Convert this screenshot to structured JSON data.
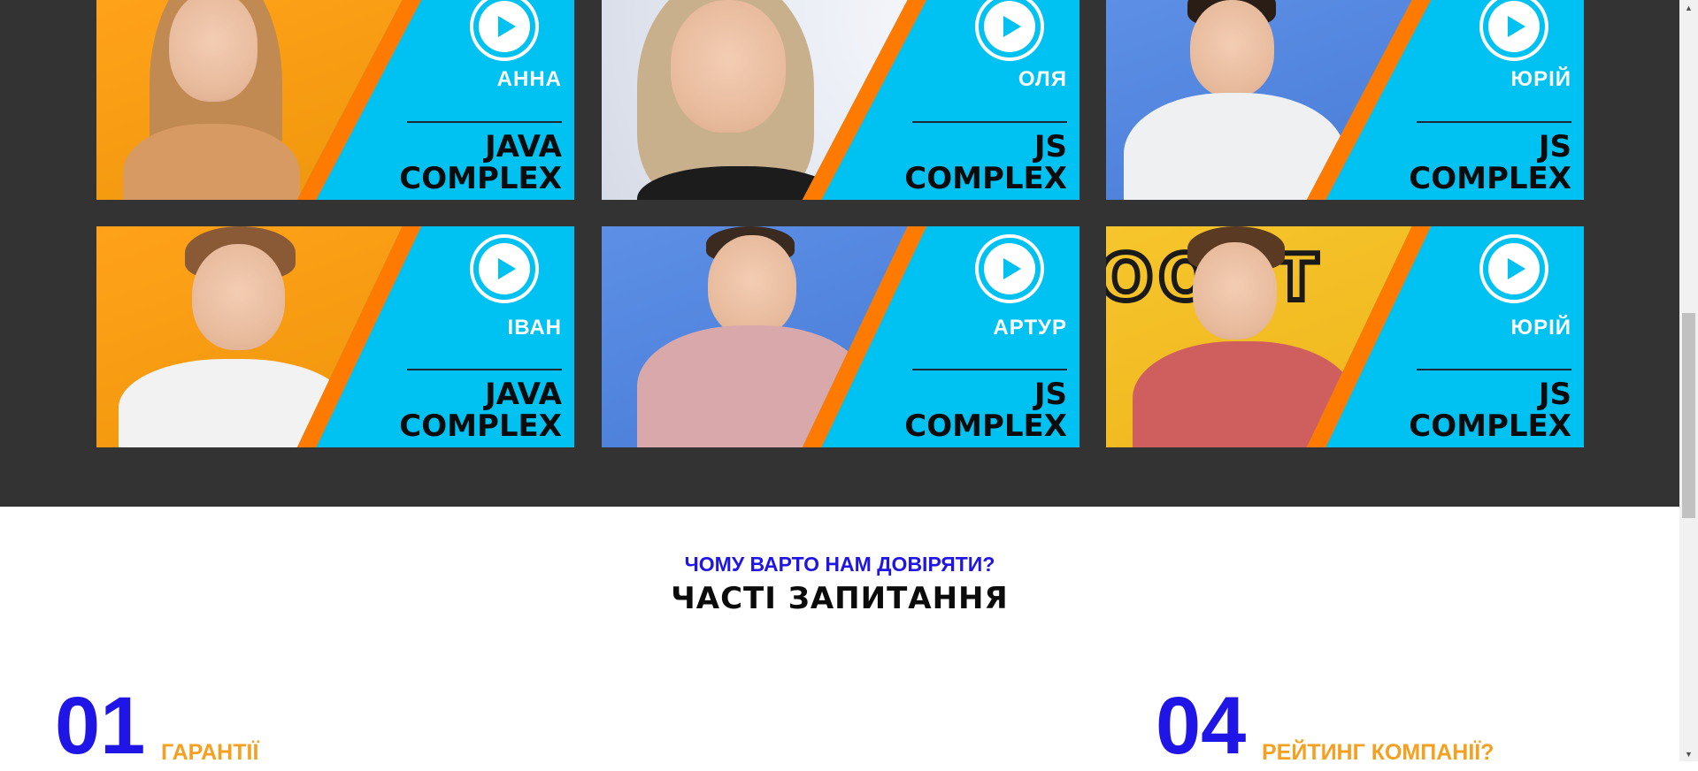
{
  "colors": {
    "dark_band": "#333333",
    "card_cyan": "#00c2f2",
    "card_stripe": "#ff7a00",
    "accent_blue": "#1f15e6",
    "accent_orange": "#f5a020"
  },
  "testimonials": {
    "cards": [
      {
        "name": "АННА",
        "course": "JAVA\nCOMPLEX",
        "icon": "play-icon"
      },
      {
        "name": "ОЛЯ",
        "course": "JS\nCOMPLEX",
        "icon": "play-icon"
      },
      {
        "name": "ЮРІЙ",
        "course": "JS\nCOMPLEX",
        "icon": "play-icon"
      },
      {
        "name": "ІВАН",
        "course": "JAVA\nCOMPLEX",
        "icon": "play-icon"
      },
      {
        "name": "АРТУР",
        "course": "JS\nCOMPLEX",
        "icon": "play-icon"
      },
      {
        "name": "ЮРІЙ",
        "course": "JS\nCOMPLEX",
        "icon": "play-icon"
      }
    ]
  },
  "faq": {
    "subtitle": "ЧОМУ ВАРТО НАМ ДОВІРЯТИ?",
    "title": "ЧАСТІ ЗАПИТАННЯ",
    "items": [
      {
        "number": "01",
        "label": "ГАРАНТІЇ"
      },
      {
        "number": "04",
        "label": "РЕЙТИНГ КОМПАНІЇ?"
      }
    ]
  },
  "scrollbar": {
    "up_icon": "chevron-up-icon",
    "down_icon": "chevron-down-icon",
    "position": 0.55
  }
}
